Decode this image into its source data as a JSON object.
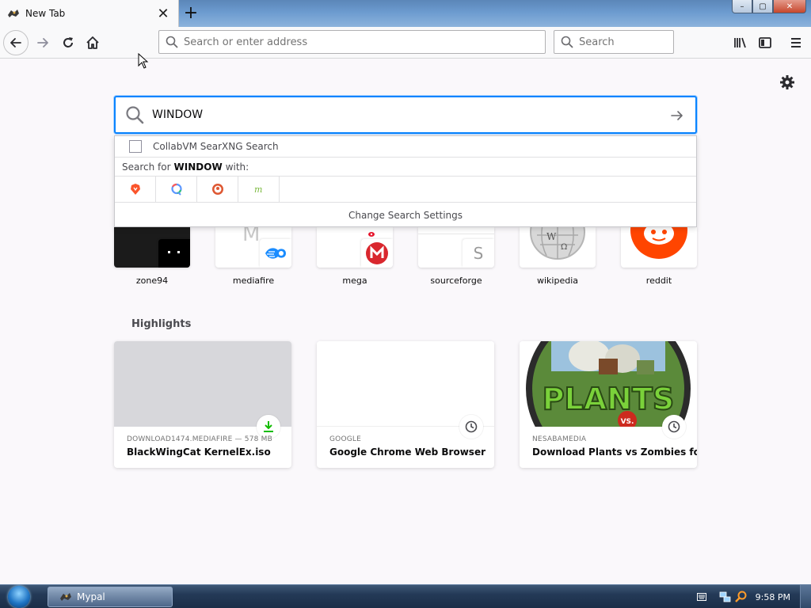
{
  "browser": {
    "tab": {
      "title": "New Tab",
      "close_glyph": "✕"
    },
    "new_tab_glyph": "+",
    "window_controls": {
      "minimize": "–",
      "maximize": "▢",
      "close": "✕"
    },
    "urlbar": {
      "placeholder": "Search or enter address"
    },
    "searchbar": {
      "placeholder": "Search"
    }
  },
  "newtab": {
    "search": {
      "value": "WINDOW",
      "suggestion": "CollabVM SearXNG Search",
      "search_for_prefix": "Search for",
      "search_for_term": "WINDOW",
      "search_for_suffix": "with:",
      "engines": [
        "brave-icon",
        "qwant-icon",
        "duckduckgo-icon",
        "mojeek-icon"
      ],
      "settings_label": "Change Search Settings"
    },
    "top_sites": [
      {
        "label": "zone94"
      },
      {
        "label": "mediafire",
        "tile_letter": "M"
      },
      {
        "label": "mega"
      },
      {
        "label": "sourceforge",
        "tile_letter": "S"
      },
      {
        "label": "wikipedia"
      },
      {
        "label": "reddit"
      }
    ],
    "highlights": {
      "title": "Highlights",
      "cards": [
        {
          "meta": "DOWNLOAD1474.MEDIAFIRE — 578 MB",
          "title": "BlackWingCat KernelEx.iso",
          "badge": "download-icon"
        },
        {
          "meta": "GOOGLE",
          "title": "Google Chrome Web Browser",
          "badge": "clock-icon"
        },
        {
          "meta": "NESABAMEDIA",
          "title": "Download Plants vs Zombies for ...",
          "badge": "clock-icon",
          "image_text": "PLANTS",
          "image_subtext": "VS."
        }
      ]
    }
  },
  "taskbar": {
    "app_label": "Mypal",
    "clock": "9:58 PM"
  },
  "colors": {
    "accent": "#0a84ff",
    "reddit": "#ff4500",
    "mega": "#d9272e",
    "mediafire": "#1a8cff",
    "download_green": "#12bc00"
  }
}
